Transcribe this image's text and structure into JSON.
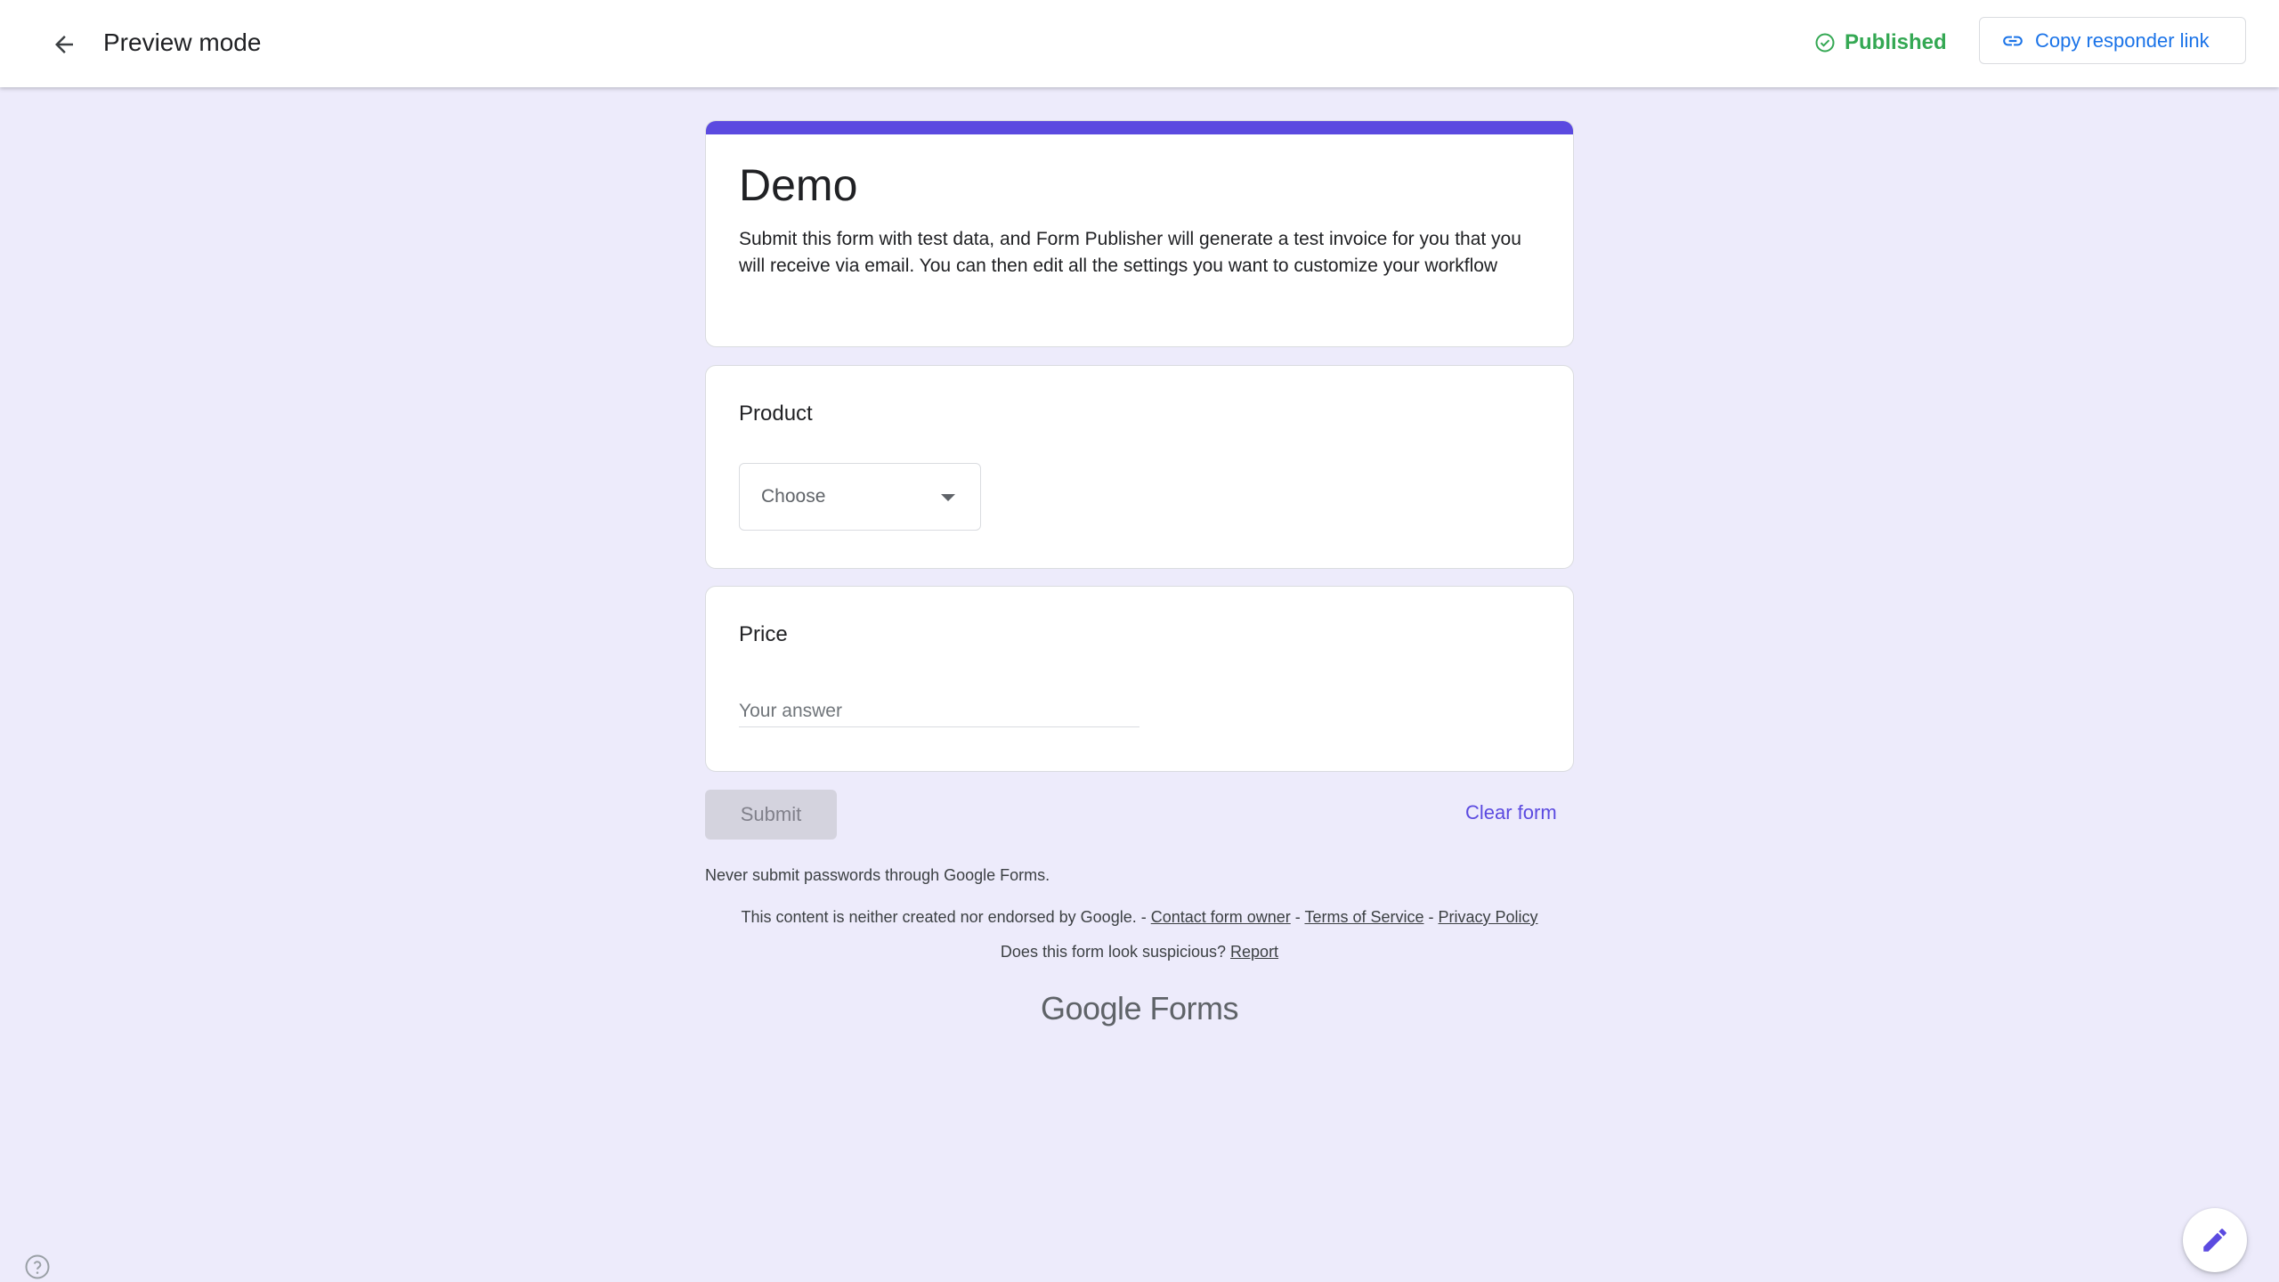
{
  "header": {
    "title": "Preview mode",
    "status": "Published",
    "copy_link_label": "Copy responder link"
  },
  "form": {
    "title": "Demo",
    "description": "Submit this form with test data, and Form Publisher will generate a test invoice for you that you will receive via email. You can then edit all the settings you want to customize your workflow",
    "questions": [
      {
        "label": "Product",
        "type": "dropdown",
        "selected": "Choose"
      },
      {
        "label": "Price",
        "type": "short-answer",
        "placeholder": "Your answer"
      }
    ],
    "submit_label": "Submit",
    "clear_label": "Clear form"
  },
  "footer": {
    "warning": "Never submit passwords through Google Forms.",
    "disclaimer_prefix": "This content is neither created nor endorsed by Google. - ",
    "contact_owner": "Contact form owner",
    "sep1": " - ",
    "terms": "Terms of Service",
    "sep2": " - ",
    "privacy": "Privacy Policy",
    "suspicious_prefix": "Does this form look suspicious? ",
    "report": "Report",
    "brand_google": "Google",
    "brand_forms": " Forms"
  },
  "colors": {
    "accent": "#5b4ae0",
    "published": "#34a853",
    "link": "#1a73e8",
    "background": "#edebfb"
  },
  "icons": {
    "back": "arrow-left-icon",
    "status": "check-circle-icon",
    "link": "link-icon",
    "dropdown": "caret-down-icon",
    "help": "help-circle-icon",
    "edit": "pencil-icon"
  }
}
